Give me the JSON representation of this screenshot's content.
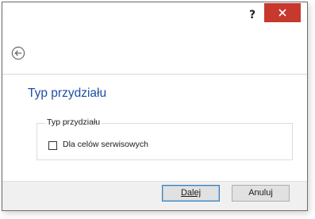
{
  "titlebar": {
    "help_label": "?",
    "close_icon": "close-icon",
    "close_color": "#c7382d"
  },
  "nav": {
    "back_icon": "back-arrow-icon"
  },
  "main": {
    "title": "Typ przydziału",
    "group": {
      "legend": "Typ przydziału",
      "checkbox_label": "Dla celów serwisowych",
      "checkbox_checked": false
    }
  },
  "footer": {
    "next_label": "Dalej",
    "cancel_label": "Anuluj"
  },
  "colors": {
    "title_blue": "#1e4fa3",
    "footer_bg": "#f0f0f0"
  }
}
